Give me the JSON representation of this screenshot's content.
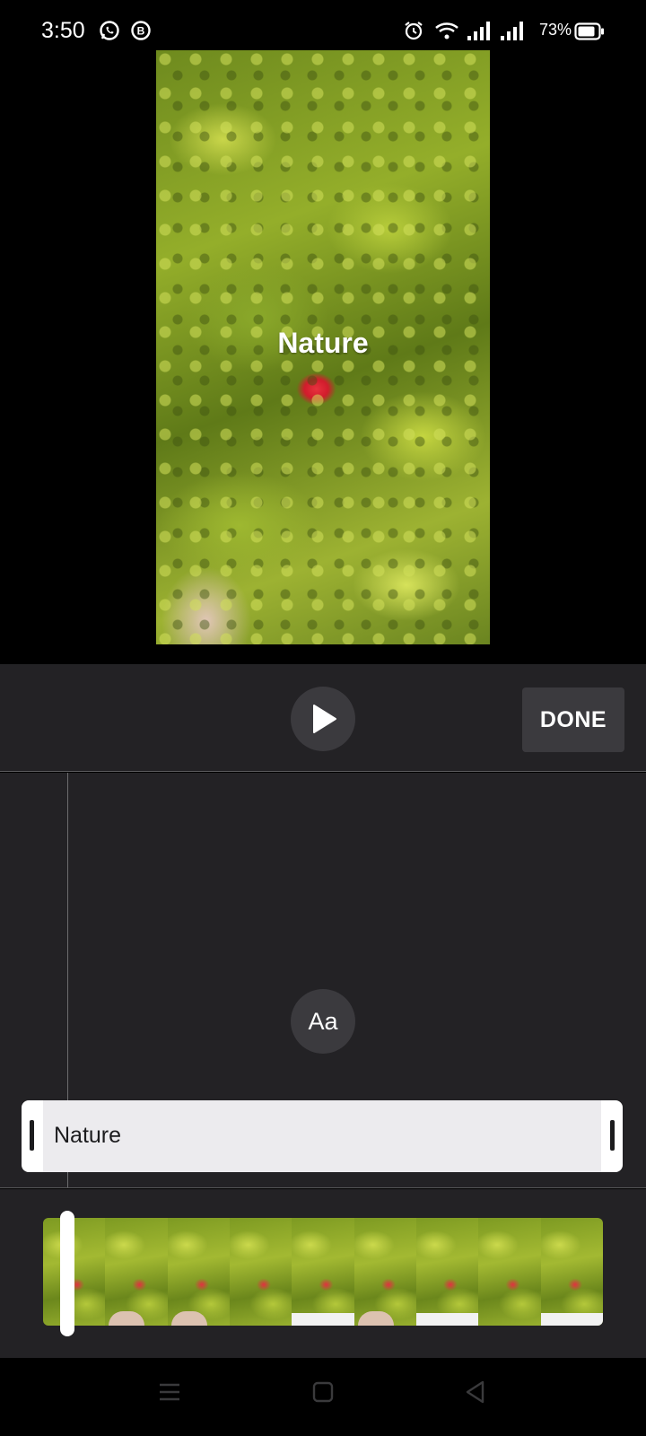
{
  "status_bar": {
    "time": "3:50",
    "battery": "73%",
    "icons": [
      "whatsapp-icon",
      "business-b-icon",
      "alarm-icon",
      "wifi-icon",
      "signal-icon",
      "signal-icon",
      "battery-icon"
    ]
  },
  "preview": {
    "overlay_text": "Nature"
  },
  "controls": {
    "play_icon": "play-icon",
    "done_label": "DONE"
  },
  "timeline": {
    "text_style_label": "Aa",
    "text_clip_label": "Nature"
  },
  "filmstrip": {
    "frame_count": 9
  },
  "nav_bar": {
    "icons": [
      "menu-icon",
      "home-icon",
      "back-icon"
    ]
  },
  "colors": {
    "panel_bg": "#232225",
    "button_bg": "#3b3a3e",
    "clip_bg": "#ecebee"
  }
}
